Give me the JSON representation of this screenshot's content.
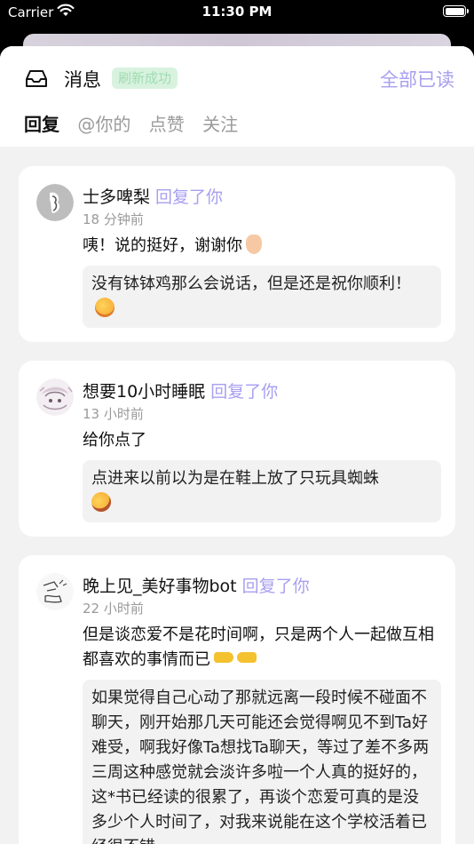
{
  "status_bar": {
    "carrier": "Carrier",
    "time": "11:30 PM"
  },
  "header": {
    "title": "消息",
    "toast": "刷新成功",
    "mark_all_read": "全部已读",
    "tabs": [
      {
        "label": "回复",
        "active": true
      },
      {
        "label": "@你的",
        "active": false
      },
      {
        "label": "点赞",
        "active": false
      },
      {
        "label": "关注",
        "active": false
      }
    ]
  },
  "notifications": [
    {
      "user": "士多啤梨",
      "action": "回复了你",
      "time_ago": "18 分钟前",
      "message": "咦！说的挺好，谢谢你",
      "quoted": "没有钵钵鸡那么会说话，但是还是祝你顺利！"
    },
    {
      "user": "想要10小时睡眠",
      "action": "回复了你",
      "time_ago": "13 小时前",
      "message": "给你点了",
      "quoted": "点进来以前以为是在鞋上放了只玩具蜘蛛"
    },
    {
      "user": "晚上见_美好事物bot",
      "action": "回复了你",
      "time_ago": "22 小时前",
      "message": "但是谈恋爱不是花时间啊，只是两个人一起做互相都喜欢的事情而已",
      "quoted": "如果觉得自己心动了那就远离一段时候不碰面不聊天，刚开始那几天可能还会觉得啊见不到Ta好难受，啊我好像Ta想找Ta聊天，等过了差不多两三周这种感觉就会淡许多啦一个人真的挺好的，这*书已经读的很累了，再谈个恋爱可真的是没多少个人时间了，对我来说能在这个学校活着已经很不错"
    }
  ],
  "colors": {
    "accent": "#a79ff0",
    "toast_bg": "#d8f2df",
    "toast_text": "#9fdcb1"
  }
}
